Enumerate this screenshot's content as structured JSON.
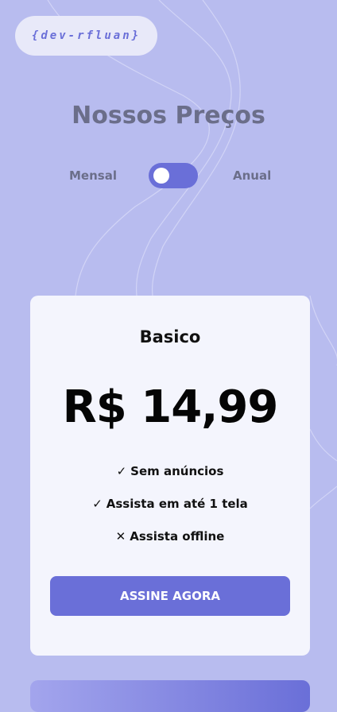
{
  "header": {
    "logo_text": "{dev-rfluan}",
    "title": "Nossos Preços"
  },
  "billing_toggle": {
    "left_label": "Mensal",
    "right_label": "Anual",
    "selected": "Mensal"
  },
  "plans": [
    {
      "name": "Basico",
      "price": "R$ 14,99",
      "features": [
        {
          "icon": "check-icon",
          "glyph": "✓",
          "text": "Sem anúncios"
        },
        {
          "icon": "check-icon",
          "glyph": "✓",
          "text": "Assista em até 1 tela"
        },
        {
          "icon": "x-icon",
          "glyph": "✕",
          "text": "Assista offline"
        }
      ],
      "cta_label": "ASSINE AGORA"
    }
  ],
  "colors": {
    "background": "#b8bcef",
    "accent": "#6a6fd8",
    "card": "#f4f5fd",
    "title": "#6b6e8a"
  }
}
